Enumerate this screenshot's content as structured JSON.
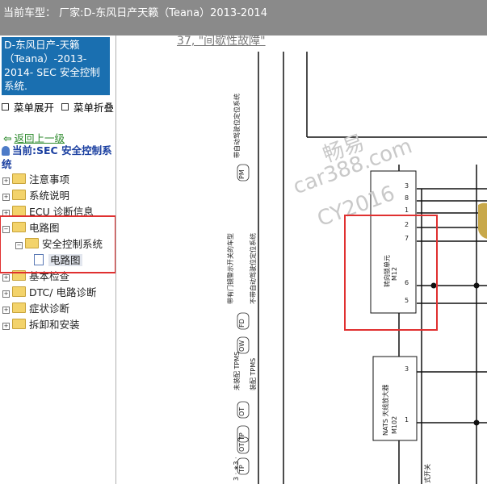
{
  "header": {
    "title": "当前车型：  厂家:D-东风日产天籁（Teana）2013-2014"
  },
  "sidebar": {
    "title": "D-东风日产-天籁（Teana）-2013-2014- SEC 安全控制系统.",
    "expand_label": "菜单展开",
    "collapse_label": "菜单折叠",
    "back_label": "返回上一级",
    "current_label": "当前:SEC 安全控制系统",
    "tree": [
      {
        "label": "注意事项"
      },
      {
        "label": "系统说明"
      },
      {
        "label": "ECU 诊断信息"
      },
      {
        "label": "电路图"
      },
      {
        "label": "安全控制系统"
      },
      {
        "label": "电路图"
      },
      {
        "label": "基本检查"
      },
      {
        "label": "DTC/ 电路诊断"
      },
      {
        "label": "症状诊断"
      },
      {
        "label": "拆卸和安装"
      }
    ]
  },
  "diagram": {
    "ref_note": "37, \"间歇性故障\"",
    "pm_note": "带自动驾驶位定位系统",
    "fd_note": "带有门镜警示开关的车型",
    "ow_note": "不带自动驾驶位定位系统",
    "ot_note": "未装配 TPMS",
    "tp_note": "装配 TPMS",
    "codes": [
      "PM",
      "FD",
      "OW",
      "OT",
      "TP",
      "OT",
      "TP"
    ],
    "note3": "3 · ∗3 ·",
    "unit1_label": "转向锁单元",
    "unit1_code": "M12",
    "unit2_label": "NATS 天线放大器",
    "unit2_code": "M102",
    "pins_unit1": [
      "3",
      "8",
      "1",
      "2",
      "7",
      "6",
      "5"
    ],
    "pins_unit2": [
      "3",
      "1"
    ],
    "bottom_label": "式开关",
    "watermark1": "畅易",
    "watermark2": "car388.com",
    "watermark3": "CY2016"
  },
  "colors": {
    "title_bg": "#1a6fb0",
    "top_bar": "#8a8a8a",
    "highlight": "#e03030",
    "link": "#2d8a2d"
  }
}
